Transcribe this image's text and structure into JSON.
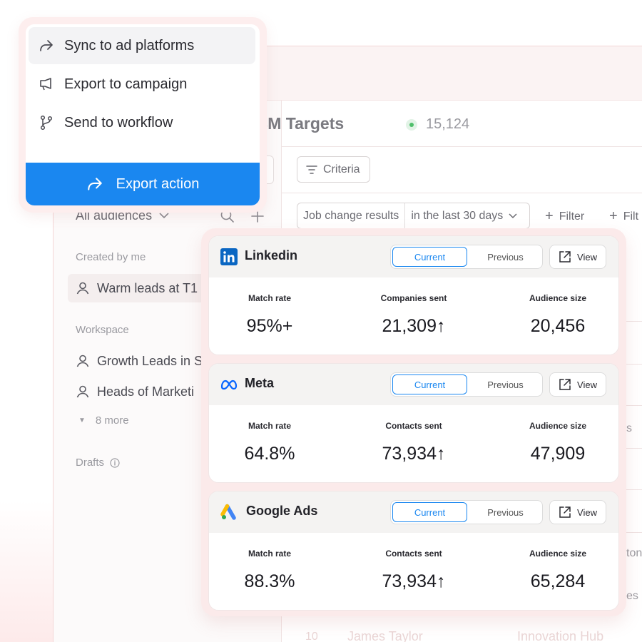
{
  "menu": {
    "items": [
      {
        "label": "Sync to ad platforms",
        "icon": "share-arrow-icon"
      },
      {
        "label": "Export to campaign",
        "icon": "megaphone-icon"
      },
      {
        "label": "Send to workflow",
        "icon": "branch-icon"
      }
    ],
    "action_label": "Export action",
    "accent": "#1a87f0"
  },
  "page": {
    "title": "ABM Targets",
    "count": "15,124",
    "criteria_label": "Criteria",
    "filter": {
      "field": "Job change results",
      "value": "in the last 30 days"
    },
    "add_filter_label": "Filter",
    "add_filter_label_2": "Filt"
  },
  "sidebar": {
    "audiences_label": "All audiences",
    "created_by_me": "Created by me",
    "my_items": [
      "Warm leads at T1"
    ],
    "workspace": "Workspace",
    "workspace_items": [
      "Growth Leads in S",
      "Heads of Marketi"
    ],
    "more_label": "8 more",
    "drafts_label": "Drafts"
  },
  "background_peek": [
    "s",
    "ton",
    "es",
    "10",
    "James Taylor",
    "Innovation Hub"
  ],
  "platforms": [
    {
      "name": "Linkedin",
      "icon": "linkedin-icon",
      "toggle": {
        "current": "Current",
        "previous": "Previous"
      },
      "view_label": "View",
      "metrics": [
        {
          "label": "Match rate",
          "value": "95%+"
        },
        {
          "label": "Companies sent",
          "value": "21,309↑"
        },
        {
          "label": "Audience size",
          "value": "20,456"
        }
      ]
    },
    {
      "name": "Meta",
      "icon": "meta-icon",
      "toggle": {
        "current": "Current",
        "previous": "Previous"
      },
      "view_label": "View",
      "metrics": [
        {
          "label": "Match rate",
          "value": "64.8%"
        },
        {
          "label": "Contacts sent",
          "value": "73,934↑"
        },
        {
          "label": "Audience size",
          "value": "47,909"
        }
      ]
    },
    {
      "name": "Google Ads",
      "icon": "google-ads-icon",
      "toggle": {
        "current": "Current",
        "previous": "Previous"
      },
      "view_label": "View",
      "metrics": [
        {
          "label": "Match rate",
          "value": "88.3%"
        },
        {
          "label": "Contacts sent",
          "value": "73,934↑"
        },
        {
          "label": "Audience size",
          "value": "65,284"
        }
      ]
    }
  ]
}
